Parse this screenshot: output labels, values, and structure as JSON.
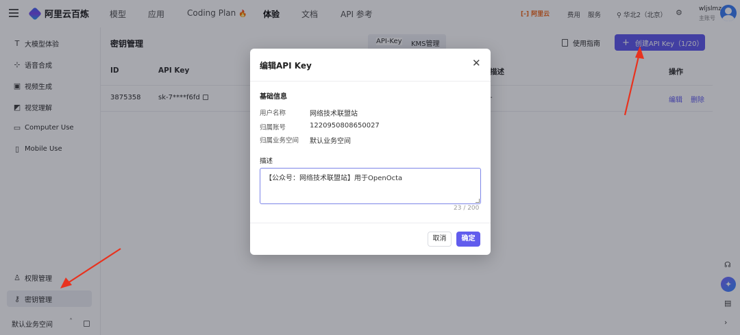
{
  "header": {
    "brand": "阿里云百炼",
    "nav": [
      {
        "label": "模型",
        "active": false
      },
      {
        "label": "应用",
        "active": false
      },
      {
        "label": "Coding Plan",
        "active": false
      },
      {
        "label": "体验",
        "active": true
      },
      {
        "label": "文档",
        "active": false
      },
      {
        "label": "API 参考",
        "active": false
      }
    ],
    "aliyun_logo": "[-] 阿里云",
    "links": [
      "费用",
      "服务"
    ],
    "region": "华北2（北京）",
    "user_name": "wljslmz",
    "user_role": "主账号"
  },
  "sidebar": {
    "items": [
      {
        "label": "大模型体验",
        "icon": "text-t-icon"
      },
      {
        "label": "语音合成",
        "icon": "waveform-icon"
      },
      {
        "label": "视频生成",
        "icon": "video-icon"
      },
      {
        "label": "视觉理解",
        "icon": "image-icon"
      },
      {
        "label": "Computer Use",
        "icon": "monitor-icon"
      },
      {
        "label": "Mobile Use",
        "icon": "mobile-icon"
      }
    ],
    "bottom_items": [
      {
        "label": "权限管理",
        "icon": "user-icon"
      },
      {
        "label": "密钥管理",
        "icon": "key-icon",
        "active": true
      }
    ],
    "workspace": "默认业务空间"
  },
  "main": {
    "title": "密钥管理",
    "tabs": [
      "API-Key",
      "KMS管理"
    ],
    "guide_label": "使用指南",
    "create_label": "创建API Key（1/20）",
    "columns": [
      "ID",
      "API Key",
      "描述",
      "操作"
    ],
    "rows": [
      {
        "id": "3875358",
        "key": "sk-7****f6fd",
        "desc": "-",
        "actions": [
          "编辑",
          "删除"
        ]
      }
    ]
  },
  "modal": {
    "title": "编辑API Key",
    "section_basic": "基础信息",
    "fields": [
      {
        "label": "用户名称",
        "value": "网络技术联盟站"
      },
      {
        "label": "归属账号",
        "value": "1220950808650027"
      },
      {
        "label": "归属业务空间",
        "value": "默认业务空间"
      }
    ],
    "desc_label": "描述",
    "desc_value": "【公众号：网络技术联盟站】用于OpenOcta",
    "counter": "23 / 200",
    "cancel_label": "取消",
    "ok_label": "确定"
  },
  "colors": {
    "accent": "#615ced",
    "annotation": "#e8321e"
  }
}
